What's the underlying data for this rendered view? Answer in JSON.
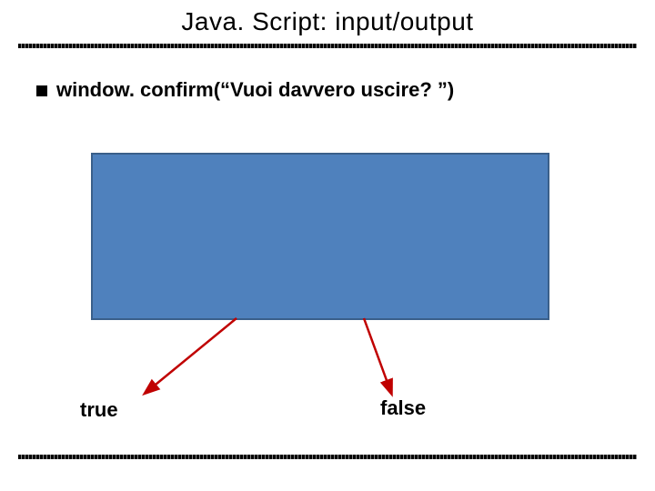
{
  "title": "Java. Script: input/output",
  "bullet": "window. confirm(“Vuoi davvero uscire? ”)",
  "labels": {
    "true": "true",
    "false": "false"
  },
  "colors": {
    "box_fill": "#4f81bd",
    "box_border": "#3a5f8a",
    "arrow": "#c00000"
  }
}
